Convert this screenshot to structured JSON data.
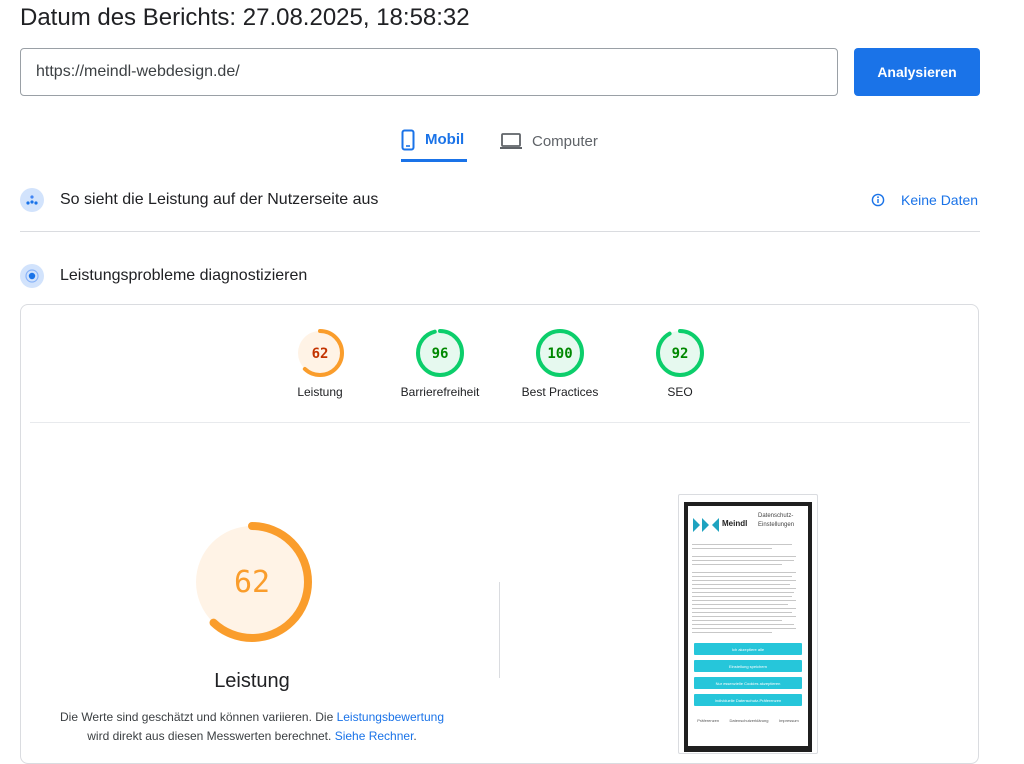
{
  "header": {
    "report_date": "Datum des Berichts: 27.08.2025, 18:58:32"
  },
  "search": {
    "url": "https://meindl-webdesign.de/",
    "analyze_label": "Analysieren"
  },
  "tabs": [
    {
      "label": "Mobil",
      "icon": "smartphone-icon",
      "active": true
    },
    {
      "label": "Computer",
      "icon": "laptop-icon",
      "active": false
    }
  ],
  "field_section": {
    "title": "So sieht die Leistung auf der Nutzerseite aus",
    "nodata_label": "Keine Daten"
  },
  "lab_section": {
    "title": "Leistungsprobleme diagnostizieren"
  },
  "scores": [
    {
      "label": "Leistung",
      "value": "62",
      "fraction": 0.62,
      "color": "#fa9d2c",
      "bg": "#fff3e6",
      "text_color": "#c33300"
    },
    {
      "label": "Barrierefreiheit",
      "value": "96",
      "fraction": 0.96,
      "color": "#0cce6b",
      "bg": "#e6f9ef",
      "text_color": "#008800"
    },
    {
      "label": "Best Practices",
      "value": "100",
      "fraction": 1.0,
      "color": "#0cce6b",
      "bg": "#e6f9ef",
      "text_color": "#008800"
    },
    {
      "label": "SEO",
      "value": "92",
      "fraction": 0.92,
      "color": "#0cce6b",
      "bg": "#e6f9ef",
      "text_color": "#008800"
    }
  ],
  "main_score": {
    "value": "62",
    "fraction": 0.62,
    "label": "Leistung",
    "color": "#fa9d2c",
    "text_color": "#fa9d2c",
    "bg": "#fff3e6"
  },
  "note": {
    "text1": "Die Werte sind geschätzt und können variieren. Die ",
    "link1": "Leistungsbewertung",
    "text2": " wird direkt aus diesen Messwerten berechnet. ",
    "link2": "Siehe Rechner",
    "text3": "."
  },
  "screenshot": {
    "brand": "Meindl",
    "dialog_title": "Datenschutz-Einstellungen",
    "buttons": [
      "Ich akzeptiere alle",
      "Einstellung speichern",
      "Nur essenzielle Cookies akzeptieren",
      "Individuelle Datenschutz-Präferenzen"
    ],
    "footer_links": [
      "Präferenzen",
      "Datenschutzerklärung",
      "Impressum"
    ]
  }
}
